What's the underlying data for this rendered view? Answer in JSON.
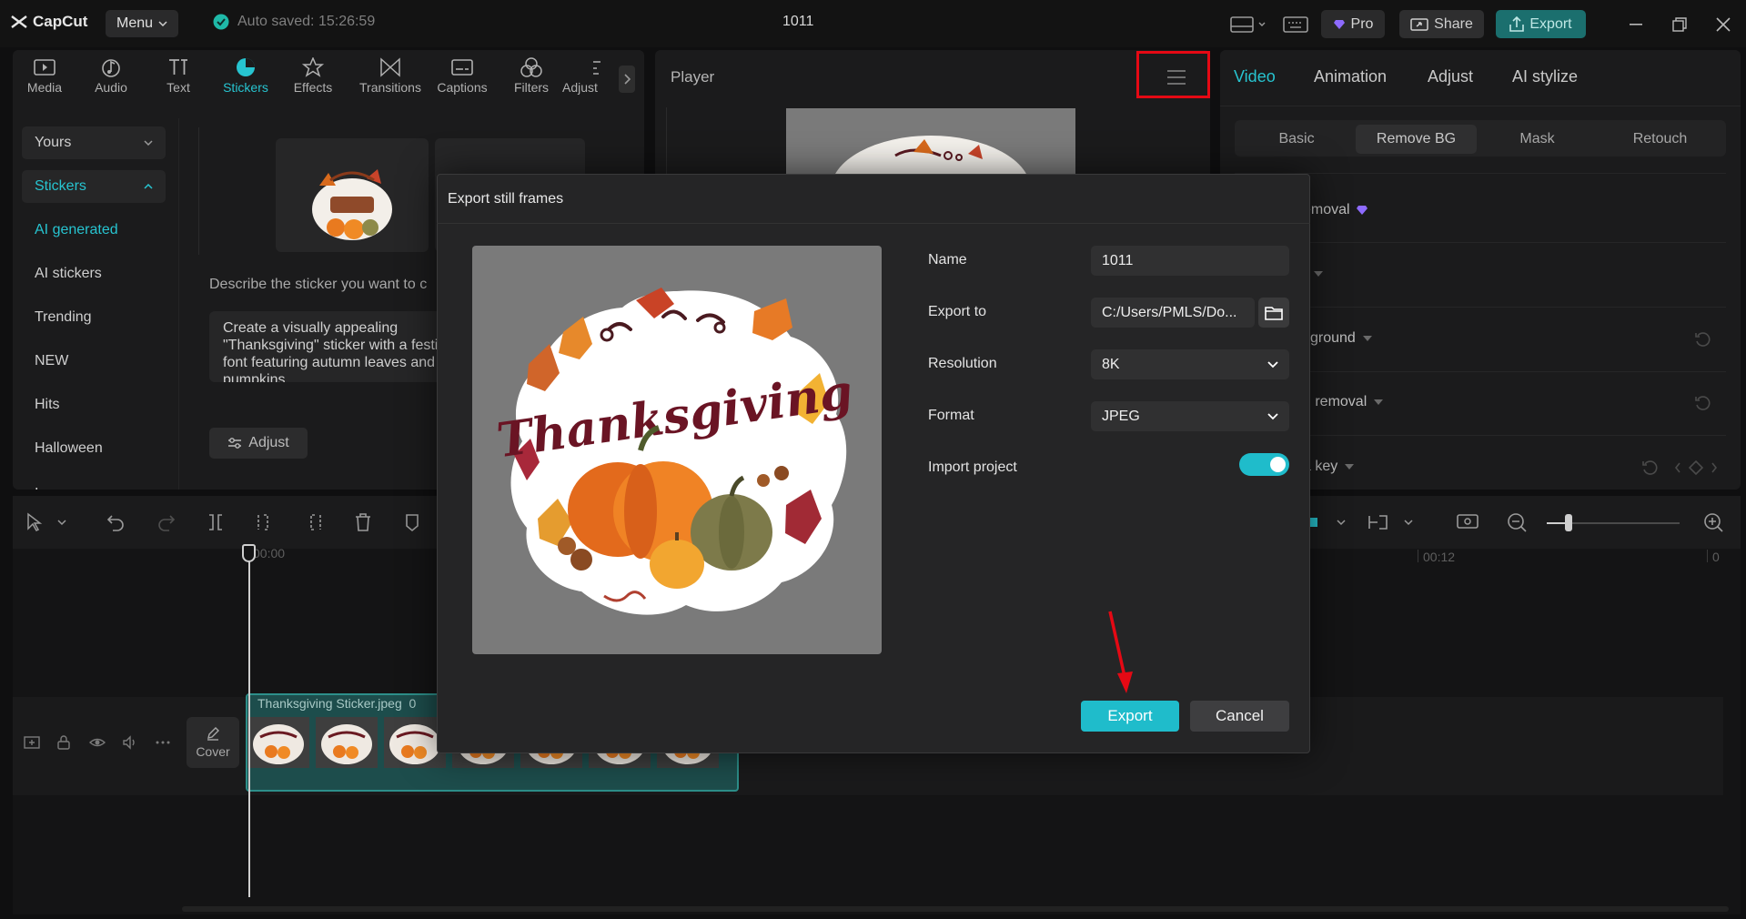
{
  "app": {
    "logo_text": "CapCut",
    "menu_label": "Menu",
    "autosave_text": "Auto saved: 15:26:59",
    "project_title": "1011",
    "pro_label": "Pro",
    "share_label": "Share",
    "export_label": "Export"
  },
  "toolbar": {
    "items": [
      {
        "label": "Media",
        "icon": "media-icon"
      },
      {
        "label": "Audio",
        "icon": "audio-icon"
      },
      {
        "label": "Text",
        "icon": "text-icon"
      },
      {
        "label": "Stickers",
        "icon": "stickers-icon"
      },
      {
        "label": "Effects",
        "icon": "effects-icon"
      },
      {
        "label": "Transitions",
        "icon": "transitions-icon"
      },
      {
        "label": "Captions",
        "icon": "captions-icon"
      },
      {
        "label": "Filters",
        "icon": "filters-icon"
      },
      {
        "label": "Adjust",
        "icon": "adjust-icon"
      }
    ],
    "active_index": 3
  },
  "sidebar": {
    "yours": "Yours",
    "stickers": "Stickers",
    "items": [
      "AI generated",
      "AI stickers",
      "Trending",
      "NEW",
      "Hits",
      "Halloween",
      "Icons"
    ],
    "active_item_index": 0
  },
  "stickers_panel": {
    "describe_label": "Describe the sticker you want to c",
    "prompt_text": "Create a visually appealing \"Thanksgiving\" sticker with a festive font featuring autumn leaves and pumpkins.",
    "adjust_label": "Adjust"
  },
  "player": {
    "title": "Player"
  },
  "right_panel": {
    "tabs": [
      "Video",
      "Animation",
      "Adjust",
      "AI stylize"
    ],
    "active_tab_index": 0,
    "subtabs": [
      "Basic",
      "Remove BG",
      "Mask",
      "Retouch"
    ],
    "active_subtab_index": 1,
    "rows": [
      "emoval",
      "",
      "kground",
      "n removal",
      "a key"
    ]
  },
  "timeline": {
    "ruler_start": "00:00",
    "ruler_mid": "00:12",
    "ruler_end": "0",
    "clip_name": "Thanksgiving Sticker.jpeg",
    "clip_duration": "0",
    "cover_label": "Cover"
  },
  "dialog": {
    "title": "Export still frames",
    "sticker_text": "Thanksgiving",
    "fields": {
      "name_label": "Name",
      "name_value": "1011",
      "export_to_label": "Export to",
      "export_to_value": "C:/Users/PMLS/Do...",
      "resolution_label": "Resolution",
      "resolution_value": "8K",
      "format_label": "Format",
      "format_value": "JPEG",
      "import_project_label": "Import project"
    },
    "import_project_enabled": true,
    "export_button": "Export",
    "cancel_button": "Cancel"
  },
  "colors": {
    "accent": "#1fbccb",
    "highlight": "#e50914",
    "background": "#0f0f10"
  }
}
